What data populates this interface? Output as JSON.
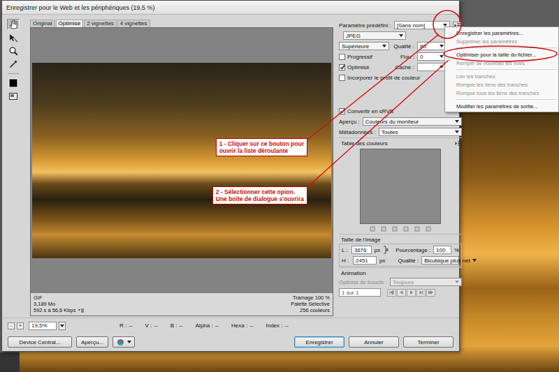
{
  "window": {
    "title": "Enregistrer pour le Web et les périphériques (19,5 %)"
  },
  "tools": [
    {
      "kind": "hand",
      "selected": true
    },
    {
      "kind": "slice",
      "selected": false
    },
    {
      "kind": "zoom",
      "selected": false
    },
    {
      "kind": "eyedropper",
      "selected": false
    }
  ],
  "view_tabs": [
    {
      "label": "Original",
      "selected": false
    },
    {
      "label": "Optimisé",
      "selected": true
    },
    {
      "label": "2 vignettes",
      "selected": false
    },
    {
      "label": "4 vignettes",
      "selected": false
    }
  ],
  "preview_info": {
    "left": [
      "GIF",
      "3,189 Mo",
      "592 s à 56,6 Kbps"
    ],
    "right": [
      "Tramage 100 %",
      "Palette Sélective",
      "256 couleurs"
    ]
  },
  "status_bar": {
    "zoom_out": "-",
    "zoom_in": "+",
    "zoom": "19,5%",
    "readouts": [
      {
        "label": "R :",
        "value": "--"
      },
      {
        "label": "V :",
        "value": "--"
      },
      {
        "label": "B :",
        "value": "--"
      },
      {
        "label": "Alpha :",
        "value": "--"
      },
      {
        "label": "Hexa :",
        "value": "--"
      },
      {
        "label": "Index :",
        "value": "--"
      }
    ]
  },
  "buttons_left": [
    "Device Central...",
    "Aperçu..."
  ],
  "buttons_right": [
    {
      "label": "Enregistrer",
      "default": true
    },
    {
      "label": "Annuler",
      "default": false
    },
    {
      "label": "Terminer",
      "default": false
    }
  ],
  "settings": {
    "preset": {
      "label": "Paramètre prédéfini :",
      "value": "[Sans nom]"
    },
    "format": "JPEG",
    "compression": "Supérieure",
    "quality": {
      "label": "Qualité :",
      "value": "80"
    },
    "blur": {
      "label": "Flou :",
      "value": "0"
    },
    "matte": {
      "label": "Cache :"
    },
    "options": [
      {
        "label": "Progressif",
        "checked": false
      },
      {
        "label": "Optimisé",
        "checked": true
      },
      {
        "label": "Incorporer le profil de couleur",
        "checked": false
      }
    ],
    "convert_srgb": {
      "label": "Convertir en sRVB",
      "checked": true
    },
    "preview": {
      "label": "Aperçu :",
      "value": "Couleurs du moniteur"
    },
    "metadata": {
      "label": "Métadonnées :",
      "value": "Toutes"
    },
    "color_table": {
      "title": "Table des couleurs"
    },
    "image_size": {
      "title": "Taille de l'image",
      "width": {
        "label": "L :",
        "value": "3676",
        "unit": "px"
      },
      "height": {
        "label": "H :",
        "value": "2451",
        "unit": "px"
      },
      "percent": {
        "label": "Pourcentage :",
        "value": "100",
        "unit": "%"
      },
      "quality": {
        "label": "Qualité :",
        "value": "Bicubique plus net"
      }
    },
    "animation": {
      "title": "Animation",
      "loop": {
        "label": "Options de boucle :",
        "value": "Toujours",
        "disabled": true
      },
      "frame": "1 sur 1"
    }
  },
  "menu": {
    "open": true,
    "items": [
      {
        "kind": "item",
        "label": "Enregistrer les paramètres...",
        "disabled": false
      },
      {
        "kind": "item",
        "label": "Supprimer les paramètres",
        "disabled": true
      },
      {
        "kind": "separator"
      },
      {
        "kind": "item",
        "label": "Optimiser pour la taille du fichier...",
        "disabled": false
      },
      {
        "kind": "item",
        "label": "Remplir de nouveau les vues",
        "disabled": true
      },
      {
        "kind": "separator"
      },
      {
        "kind": "item",
        "label": "Lier les tranches",
        "disabled": true
      },
      {
        "kind": "item",
        "label": "Rompre les liens des tranches",
        "disabled": true
      },
      {
        "kind": "item",
        "label": "Rompre tous les liens des tranches",
        "disabled": true
      },
      {
        "kind": "separator"
      },
      {
        "kind": "item",
        "label": "Modifier les paramètres de sortie...",
        "disabled": false
      }
    ]
  },
  "annotations": [
    {
      "lines": [
        "1 - Cliquer sur ce bouton pour",
        "ouvrir la liste déroulante"
      ]
    },
    {
      "lines": [
        "2 - Sélectionner cette opion.",
        "Une boite de dialogue s'ouvrira"
      ]
    }
  ]
}
